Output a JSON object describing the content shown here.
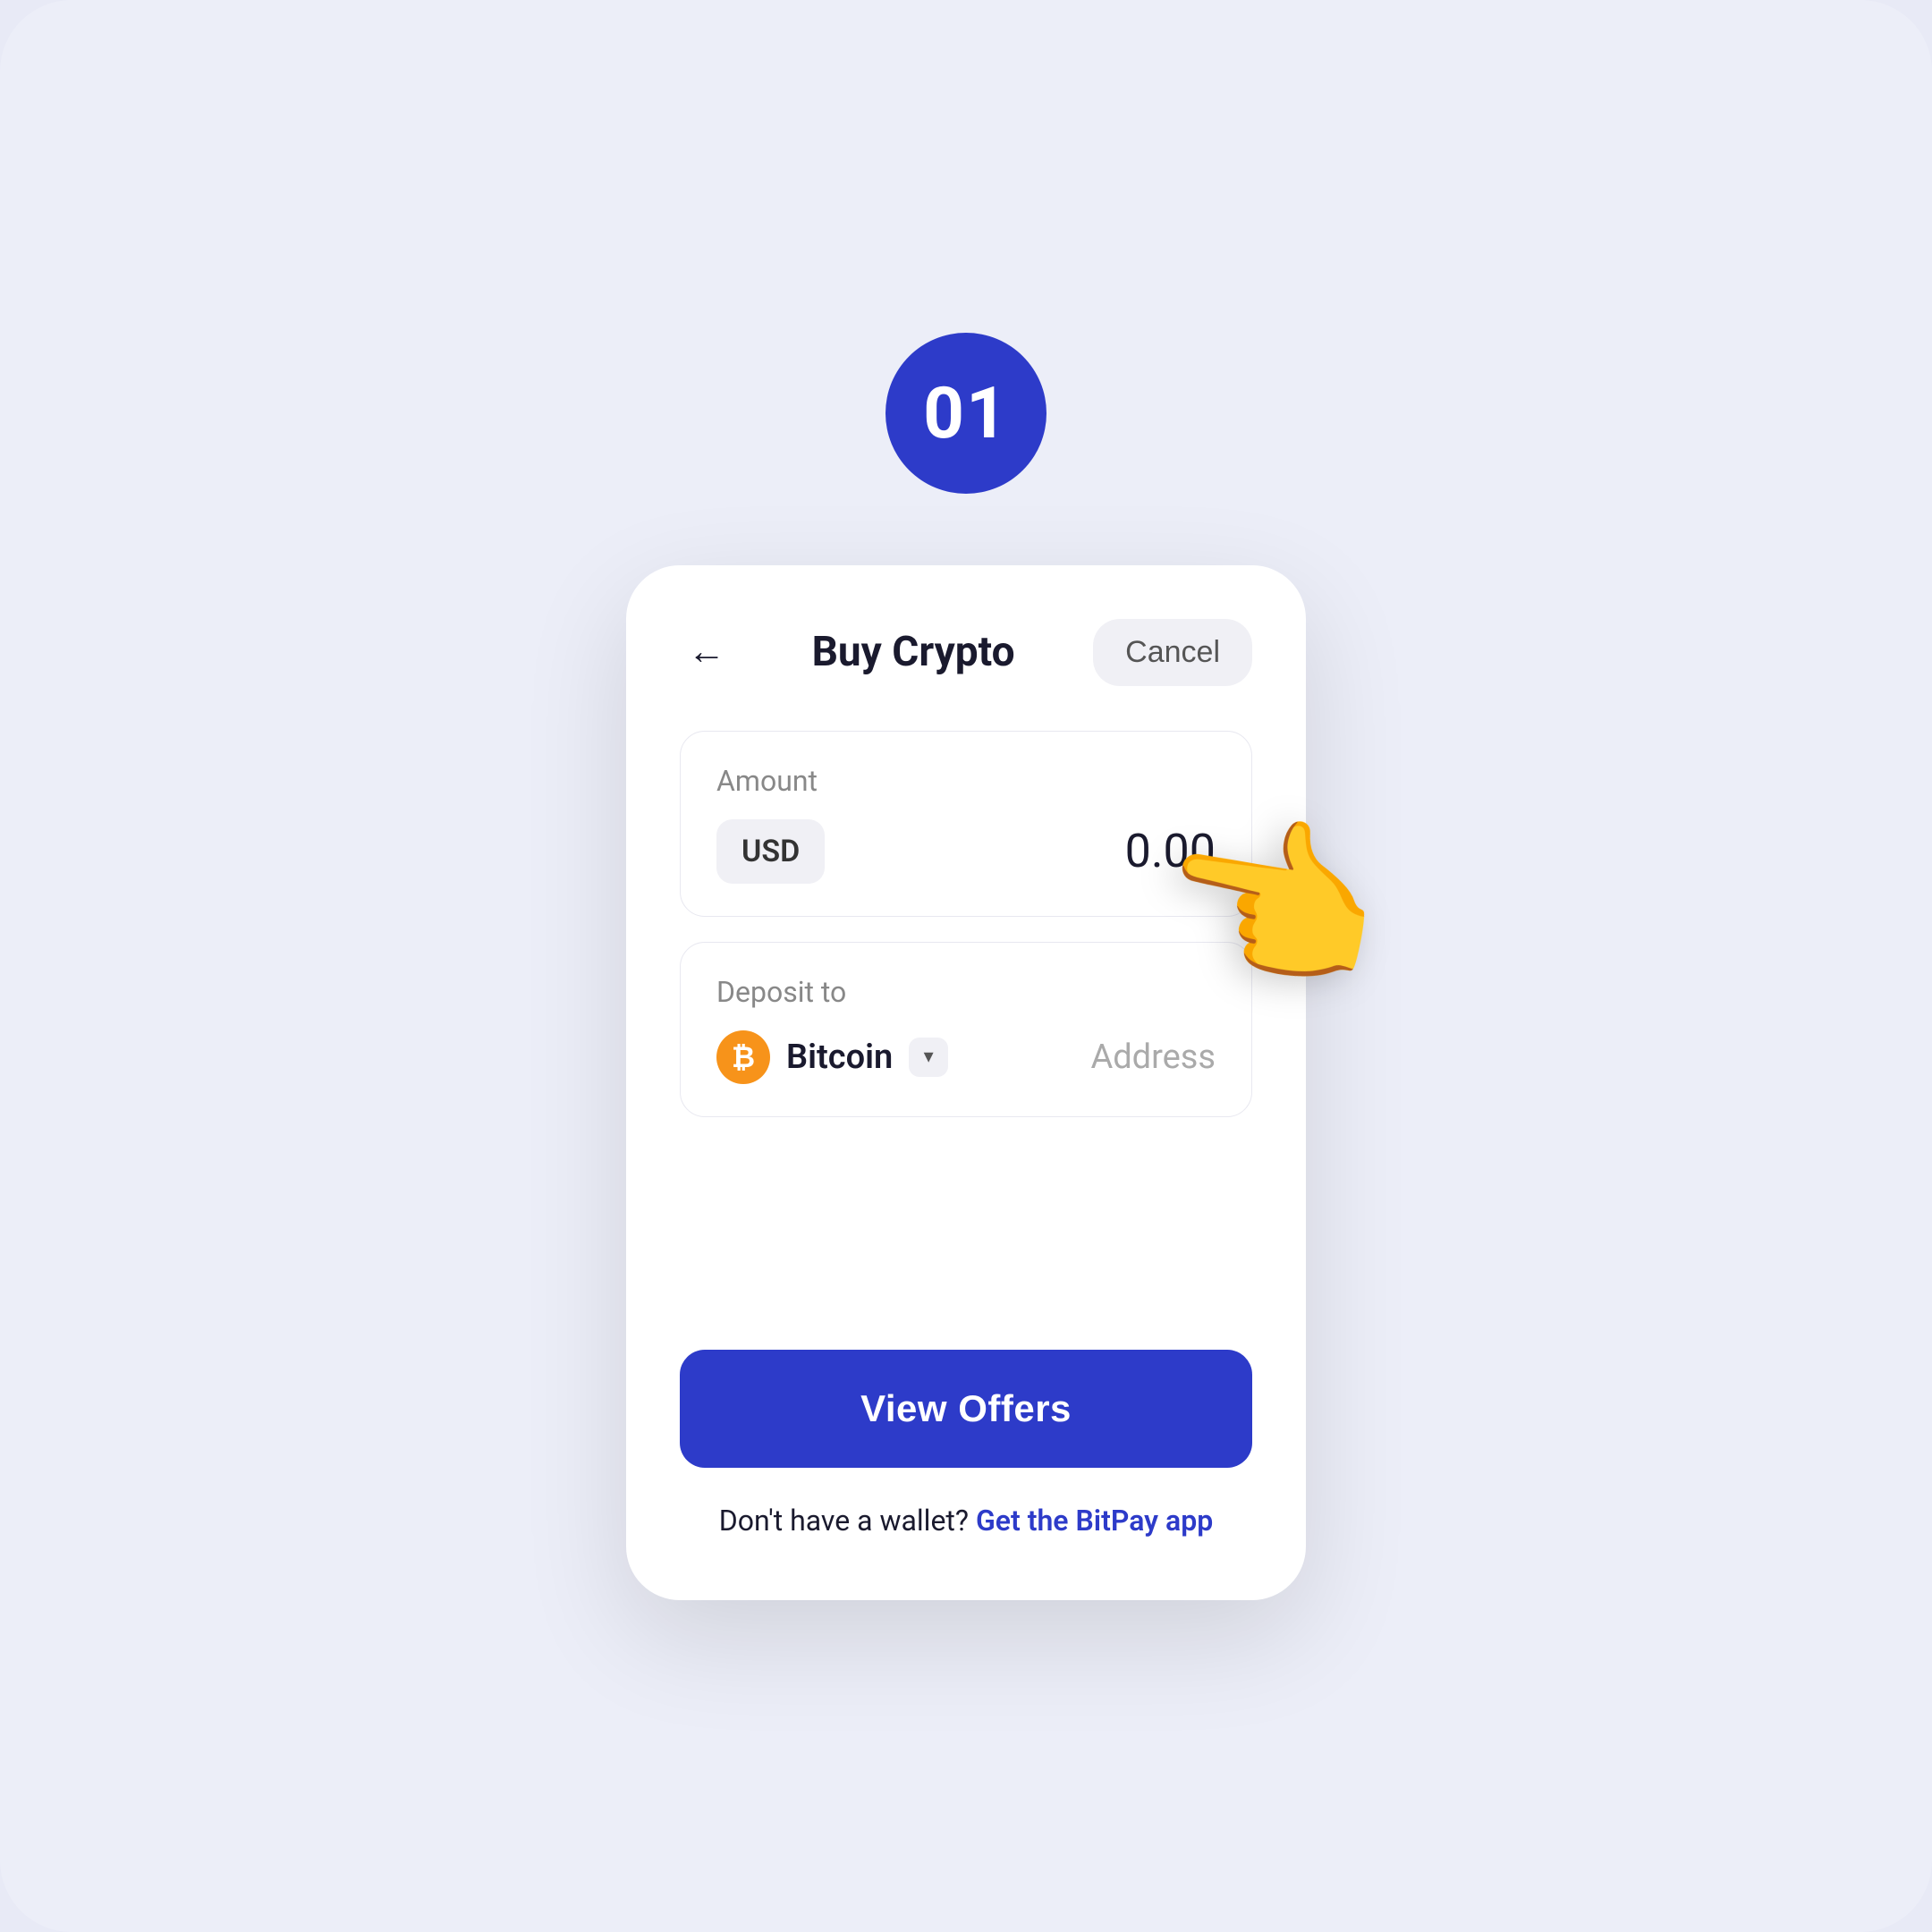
{
  "page": {
    "background_color": "#eceef8"
  },
  "step_badge": {
    "number": "01"
  },
  "header": {
    "title": "Buy Crypto",
    "cancel_label": "Cancel",
    "back_aria": "Back"
  },
  "amount_section": {
    "label": "Amount",
    "currency": "USD",
    "value": "0.00"
  },
  "deposit_section": {
    "label": "Deposit to",
    "crypto_name": "Bitcoin",
    "address_placeholder": "Address"
  },
  "footer": {
    "cta_button": "View Offers",
    "wallet_text_prefix": "Don't have a wallet?",
    "wallet_link": "Get the BitPay app"
  }
}
